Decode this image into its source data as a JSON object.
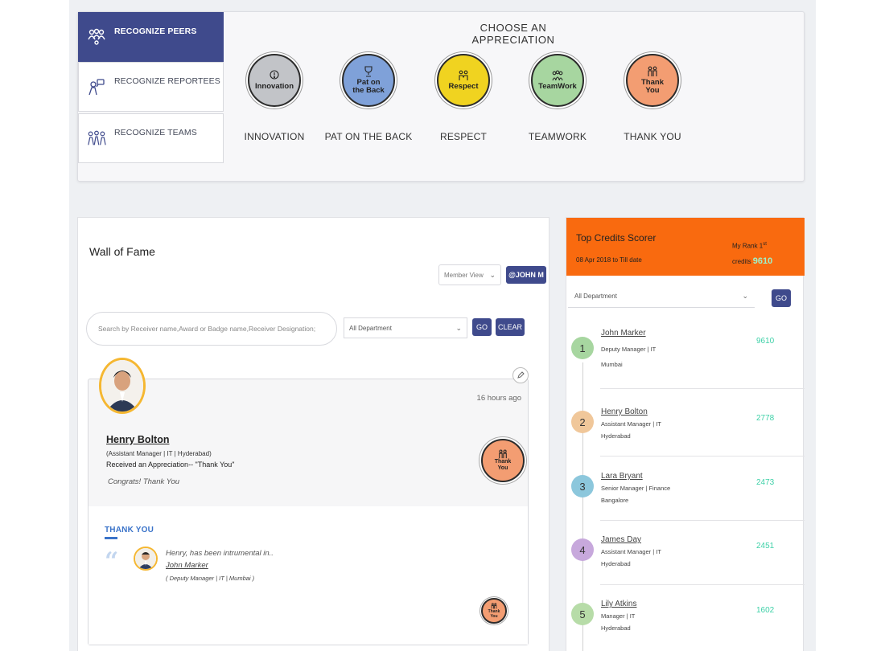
{
  "recognize_tabs": [
    {
      "label": "RECOGNIZE PEERS",
      "icon": "peers-icon",
      "active": true
    },
    {
      "label": "RECOGNIZE REPORTEES",
      "icon": "reportees-icon",
      "active": false
    },
    {
      "label": "RECOGNIZE TEAMS",
      "icon": "teams-icon",
      "active": false
    }
  ],
  "appreciation": {
    "title": "CHOOSE AN APPRECIATION",
    "badges": [
      {
        "label": "INNOVATION",
        "badge_text": "Innovation",
        "color": "#c2c4c8",
        "icon": "lightbulb-icon"
      },
      {
        "label": "PAT ON THE BACK",
        "badge_text": "Pat on the Back",
        "color": "#7fa1d9",
        "icon": "trophy-icon"
      },
      {
        "label": "RESPECT",
        "badge_text": "Respect",
        "color": "#f0d320",
        "icon": "handshake-icon"
      },
      {
        "label": "TEAMWORK",
        "badge_text": "TeamWork",
        "color": "#a7d6a0",
        "icon": "group-icon"
      },
      {
        "label": "THANK YOU",
        "badge_text": "Thank You",
        "color": "#f39d72",
        "icon": "people-icon"
      }
    ]
  },
  "wall": {
    "title": "Wall of Fame",
    "member_view": "Member View",
    "john_button": "@JOHN M",
    "search_placeholder": "Search by Receiver name,Award or Badge name,Receiver Designation;",
    "department": "All Department",
    "go": "GO",
    "clear": "CLEAR",
    "post": {
      "time": "16 hours ago",
      "name": "Henry Bolton",
      "designation": "(Assistant Manager | IT | Hyderabad)",
      "description": "Received an Appreciation-- \"Thank You\"",
      "message": "Congrats! Thank You",
      "badge_text": "Thank You",
      "comment_tab": "THANK YOU",
      "comment_text": "Henry, has been intrumental in..",
      "comment_author": "John Marker",
      "comment_designation": "( Deputy Manager | IT | Mumbai )",
      "comment_badge_text": "Thank You"
    }
  },
  "credits": {
    "title": "Top Credits Scorer",
    "dates": "08 Apr 2018 to Till date",
    "my_rank_label": "My Rank",
    "my_rank_value": "1",
    "my_rank_suffix": "st",
    "credits_label": "credits",
    "credits_value": "9610",
    "department": "All Department",
    "go": "GO",
    "scorers": [
      {
        "rank": "1",
        "name": "John Marker",
        "designation": "Deputy Manager | IT",
        "city": "Mumbai",
        "score": "9610",
        "color": "#a7d6a0"
      },
      {
        "rank": "2",
        "name": "Henry Bolton",
        "designation": "Assistant Manager | IT",
        "city": "Hyderabad",
        "score": "2778",
        "color": "#f0c79a"
      },
      {
        "rank": "3",
        "name": "Lara Bryant",
        "designation": "Senior Manager | Finance",
        "city": "Bangalore",
        "score": "2473",
        "color": "#8cc7dc"
      },
      {
        "rank": "4",
        "name": "James Day",
        "designation": "Assistant Manager | IT",
        "city": "Hyderabad",
        "score": "2451",
        "color": "#c7a8dc"
      },
      {
        "rank": "5",
        "name": "Lily Atkins",
        "designation": "Manager | IT",
        "city": "Hyderabad",
        "score": "1602",
        "color": "#b7dca8"
      }
    ]
  }
}
